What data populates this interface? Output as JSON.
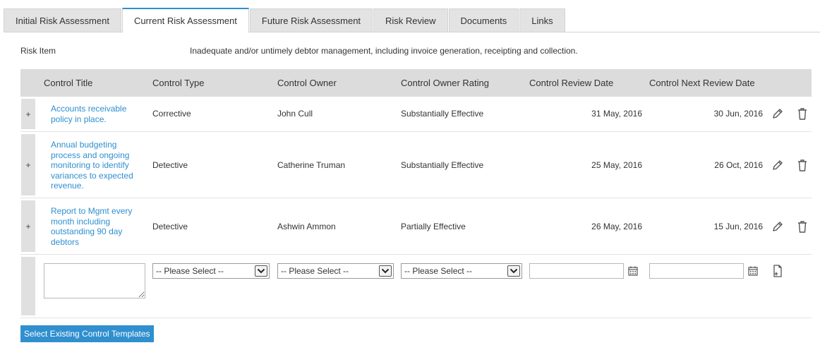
{
  "tabs": [
    {
      "label": "Initial Risk Assessment"
    },
    {
      "label": "Current Risk Assessment"
    },
    {
      "label": "Future Risk Assessment"
    },
    {
      "label": "Risk Review"
    },
    {
      "label": "Documents"
    },
    {
      "label": "Links"
    }
  ],
  "active_tab": "Current Risk Assessment",
  "risk_item": {
    "label": "Risk Item",
    "text": "Inadequate and/or untimely debtor management, including invoice generation, receipting and collection."
  },
  "columns": {
    "control_title": "Control Title",
    "control_type": "Control Type",
    "control_owner": "Control Owner",
    "control_owner_rating": "Control Owner Rating",
    "control_review_date": "Control Review Date",
    "control_next_review_date": "Control Next Review Date"
  },
  "rows": [
    {
      "expand": "+",
      "title_lines": [
        "Accounts receivable",
        "policy in place."
      ],
      "type": "Corrective",
      "owner": "John Cull",
      "rating": "Substantially Effective",
      "review_date": "31 May, 2016",
      "next_review_date": "30 Jun, 2016"
    },
    {
      "expand": "+",
      "title_lines": [
        "Annual budgeting",
        "process and ongoing",
        "monitoring to identify",
        "variances to expected",
        "revenue."
      ],
      "type": "Detective",
      "owner": "Catherine Truman",
      "rating": "Substantially Effective",
      "review_date": "25 May, 2016",
      "next_review_date": "26 Oct, 2016"
    },
    {
      "expand": "+",
      "title_lines": [
        "Report to Mgmt every",
        "month including",
        "outstanding 90 day",
        "debtors"
      ],
      "type": "Detective",
      "owner": "Ashwin Ammon",
      "rating": "Partially Effective",
      "review_date": "26 May, 2016",
      "next_review_date": "15 Jun, 2016"
    }
  ],
  "new_row": {
    "type_select": "-- Please Select --",
    "owner_select": "-- Please Select --",
    "rating_select": "-- Please Select --"
  },
  "buttons": {
    "select_templates": "Select Existing Control Templates"
  },
  "icons": {
    "edit": "pencil-icon",
    "delete": "trash-icon",
    "calendar": "calendar-icon",
    "add": "add-document-icon",
    "dropdown": "chevron-down-icon"
  },
  "colors": {
    "accent": "#2f8fcf",
    "header_bg": "#dcdcdc",
    "tab_bg": "#e3e3e3"
  }
}
